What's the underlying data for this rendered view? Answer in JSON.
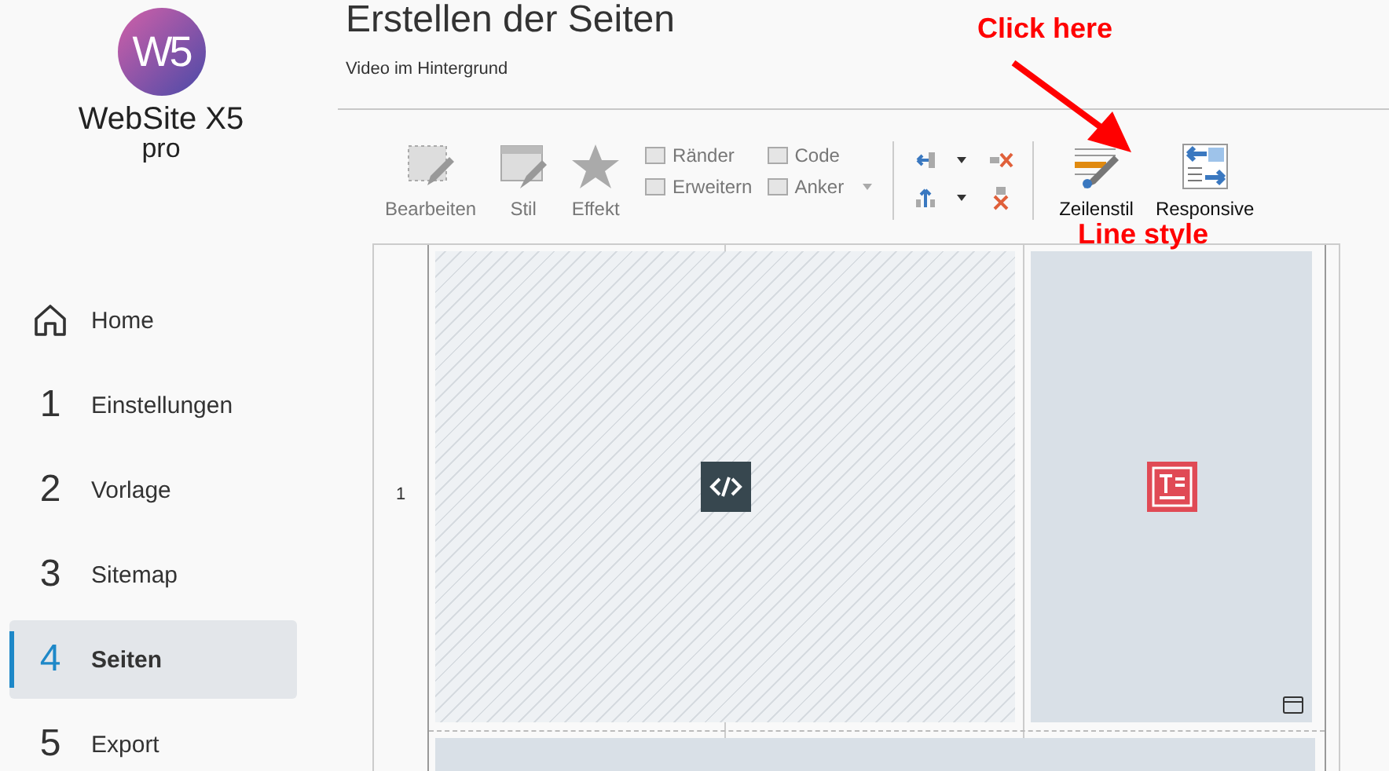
{
  "logo": {
    "mark": "W5",
    "name": "WebSite X5",
    "edition": "pro"
  },
  "nav": [
    {
      "kind": "home",
      "label": "Home",
      "selected": false
    },
    {
      "kind": "step",
      "number": "1",
      "label": "Einstellungen",
      "selected": false
    },
    {
      "kind": "step",
      "number": "2",
      "label": "Vorlage",
      "selected": false
    },
    {
      "kind": "step",
      "number": "3",
      "label": "Sitemap",
      "selected": false
    },
    {
      "kind": "step",
      "number": "4",
      "label": "Seiten",
      "selected": true
    },
    {
      "kind": "step",
      "number": "5",
      "label": "Export",
      "selected": false
    }
  ],
  "header": {
    "title": "Erstellen der Seiten",
    "subtitle": "Video im Hintergrund"
  },
  "toolbar": {
    "large": [
      {
        "kind": "edit",
        "label": "Bearbeiten",
        "disabled": true
      },
      {
        "kind": "style",
        "label": "Stil",
        "disabled": true
      },
      {
        "kind": "effect",
        "label": "Effekt",
        "disabled": true
      }
    ],
    "small": [
      {
        "kind": "margins",
        "label": "Ränder",
        "disabled": true
      },
      {
        "kind": "code",
        "label": "Code",
        "disabled": true
      },
      {
        "kind": "expand",
        "label": "Erweitern",
        "disabled": true
      },
      {
        "kind": "anchor",
        "label": "Anker",
        "disabled": true
      }
    ],
    "row_tools": [
      {
        "kind": "row-style",
        "label": "Zeilenstil",
        "disabled": false
      },
      {
        "kind": "responsive",
        "label": "Responsive",
        "disabled": false
      }
    ]
  },
  "grid": {
    "row_number": "1"
  },
  "annotations": {
    "top": "Click here",
    "bottom": "Line style"
  }
}
